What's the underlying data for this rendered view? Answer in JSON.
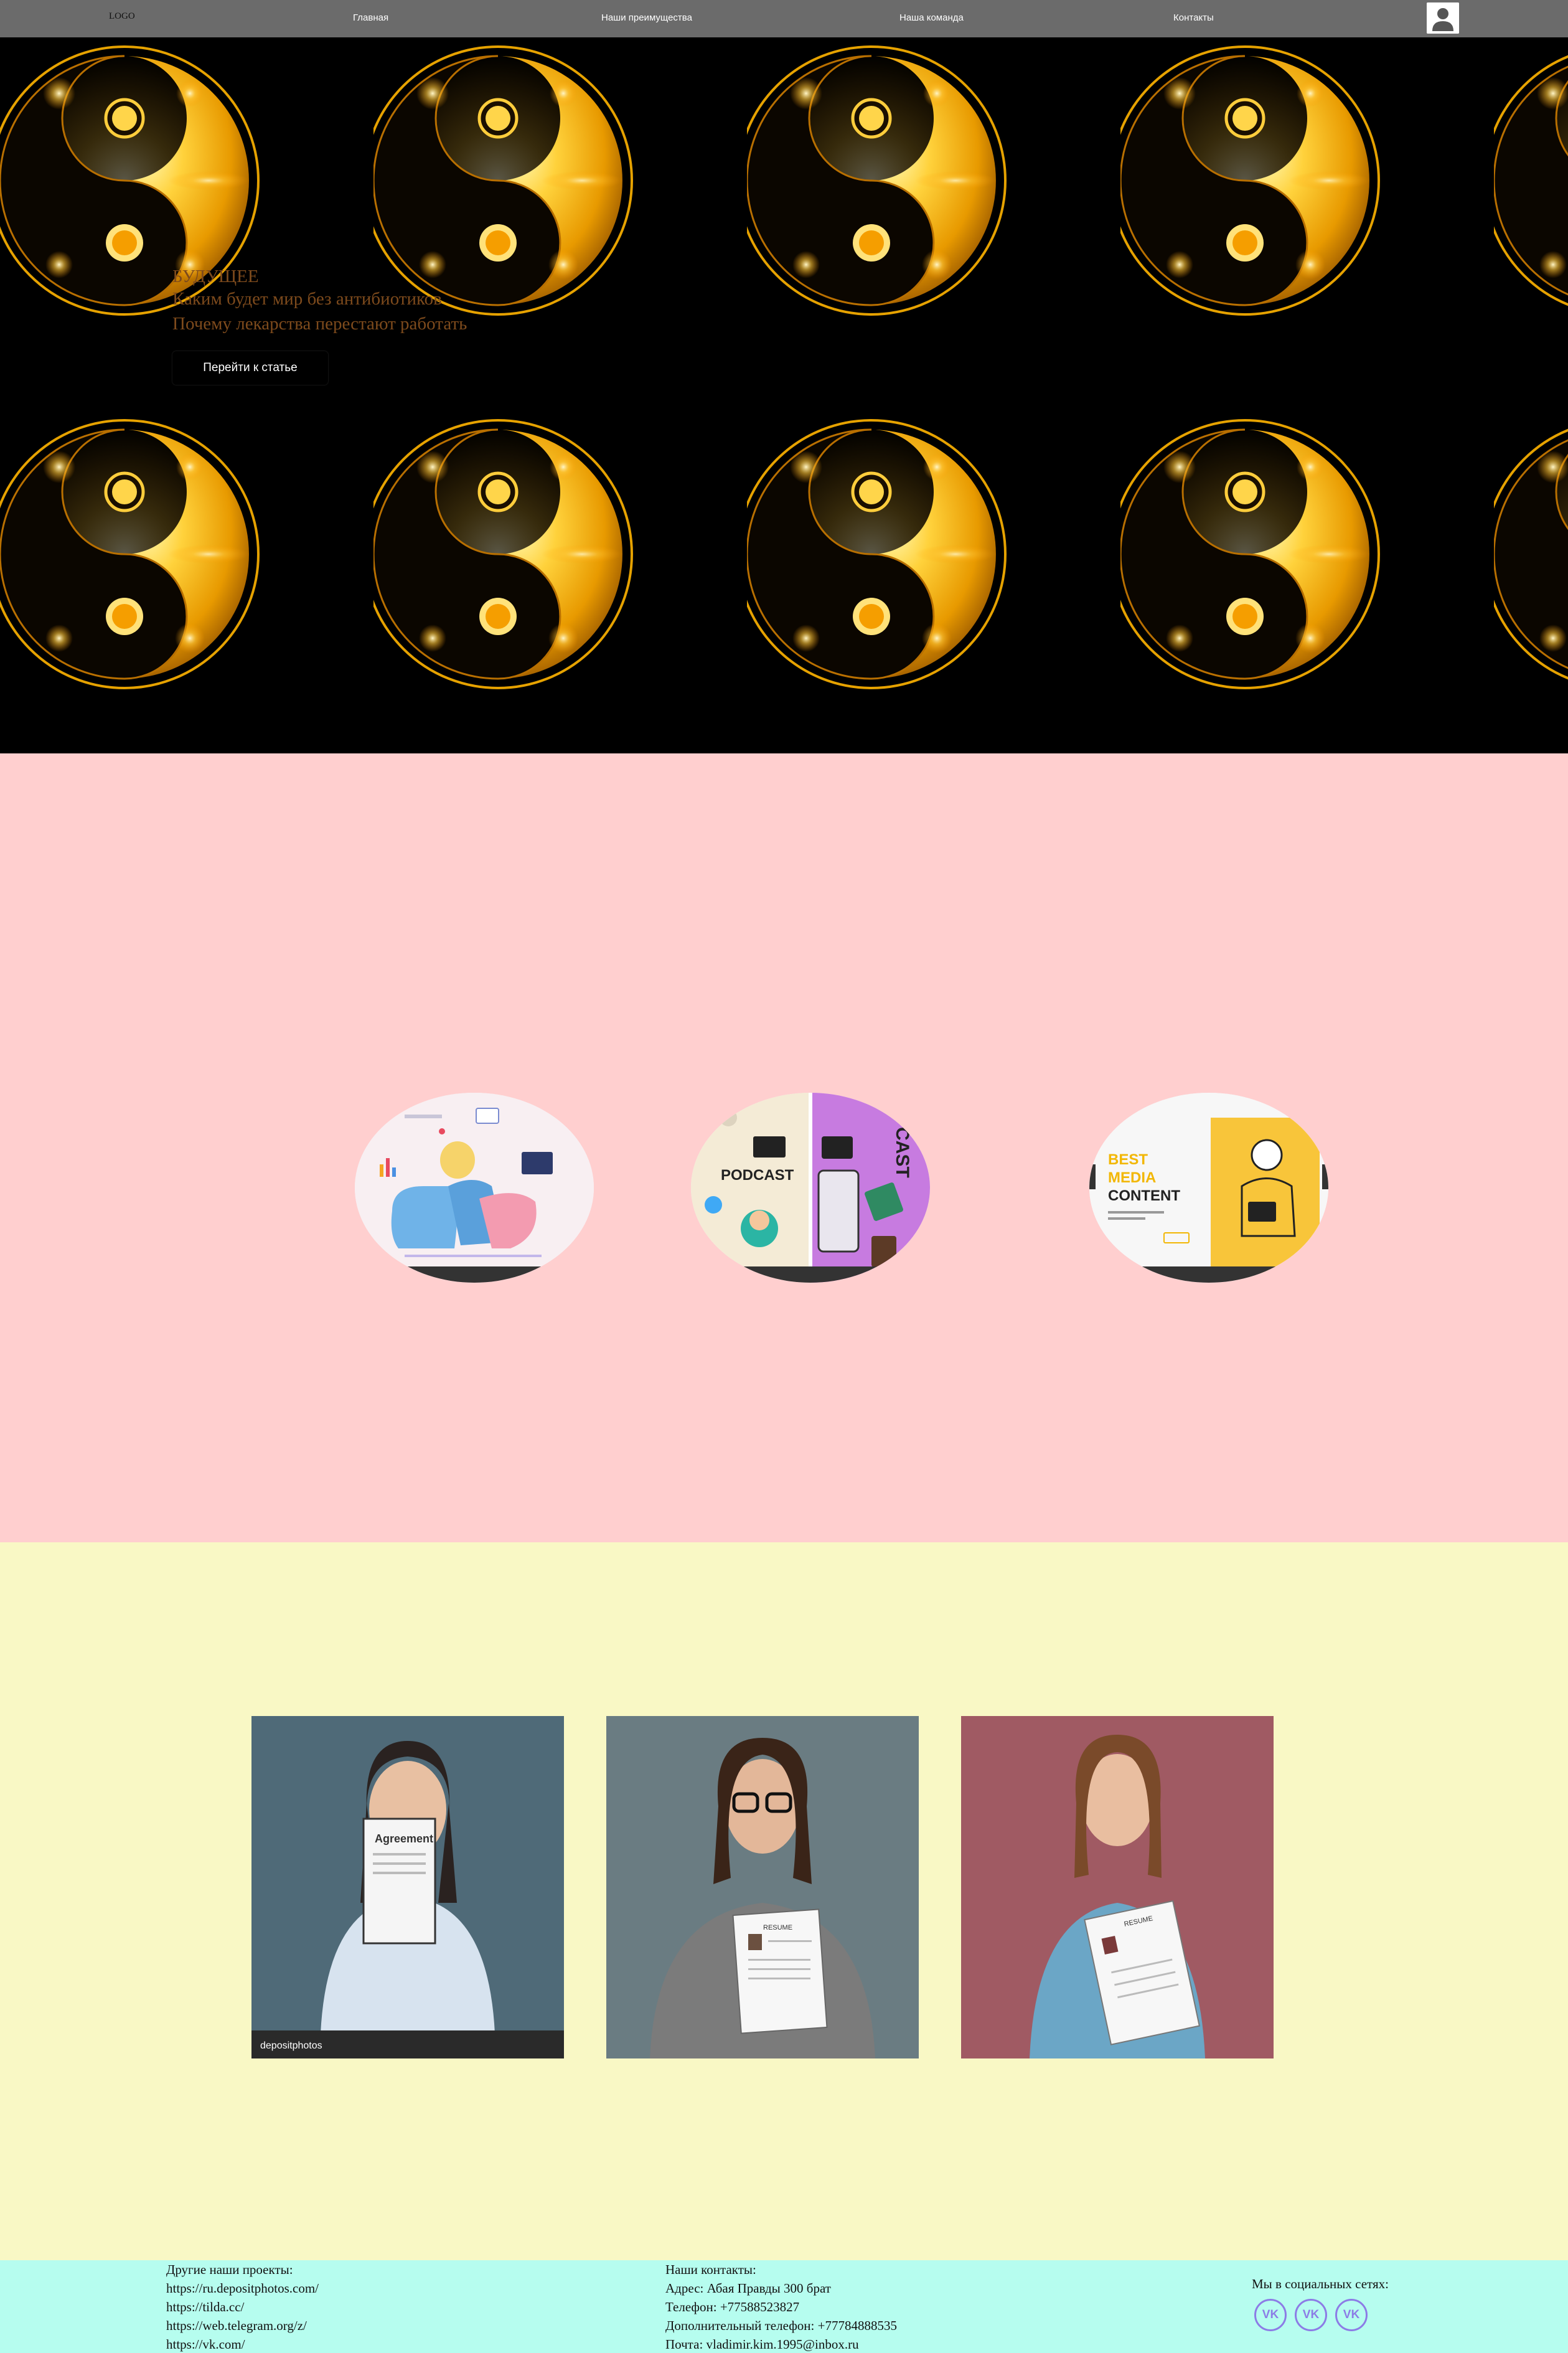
{
  "nav": {
    "logo": "LOGO",
    "links": [
      "Главная",
      "Наши преимущества",
      "Наша команда",
      "Контакты"
    ]
  },
  "hero": {
    "kicker": "БУДУЩЕЕ",
    "title": "Каким будет мир без антибиотиков",
    "subtitle": "Почему лекарства перестают работать",
    "button": "Перейти к статье"
  },
  "cards": {
    "illustrations": [
      "woman-with-laptop-illustration",
      "podcast-illustration",
      "best-media-content-illustration"
    ],
    "oval3": {
      "headline_1": "BEST",
      "headline_2": "MEDIA",
      "headline_3": "CONTENT"
    },
    "oval2": {
      "podcast": "PODCAST",
      "cast": "CAST"
    }
  },
  "team": {
    "photos": [
      "woman-with-agreement-photo",
      "woman-with-resume-glasses-photo",
      "woman-with-resume-photo"
    ],
    "photo1_doc": "Agreement",
    "photo1_brand": "depositphotos",
    "photo2_doc": "RESUME",
    "photo3_doc": "RESUME"
  },
  "footer": {
    "projects_title": "Другие наши проекты:",
    "projects": [
      "https://ru.depositphotos.com/",
      "https://tilda.cc/",
      "https://web.telegram.org/z/",
      "https://vk.com/"
    ],
    "contacts_title": "Наши контакты:",
    "contacts": [
      "Адрес: Абая Правды 300 брат",
      "Телефон: +77588523827",
      "Дополнительный телефон: +77784888535",
      "Почта: vladimir.kim.1995@inbox.ru"
    ],
    "social_title": "Мы в социальных сетях:",
    "social": [
      "VK",
      "VK",
      "VK"
    ]
  },
  "colors": {
    "nav_bg": "#6b6b6b",
    "hero_bg": "#000000",
    "hero_text": "#7d4a1c",
    "gold": "#f6a400",
    "pink_bg": "#ffcfcf",
    "yellow_bg": "#f9f8c5",
    "footer_bg": "#b6fdef",
    "vk_accent": "#8c7ce6"
  }
}
